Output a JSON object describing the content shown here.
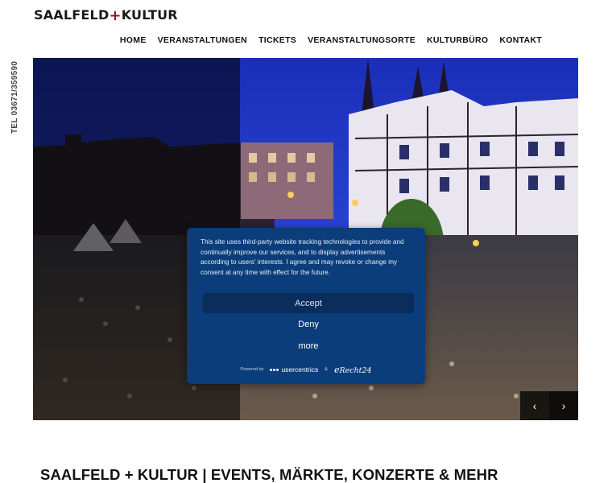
{
  "logo": {
    "left": "SAALFELD",
    "plus": "+",
    "right": "KULTUR"
  },
  "nav": {
    "items": [
      {
        "label": "HOME"
      },
      {
        "label": "VERANSTALTUNGEN"
      },
      {
        "label": "TICKETS"
      },
      {
        "label": "VERANSTALTUNGSORTE"
      },
      {
        "label": "KULTURBÜRO"
      },
      {
        "label": "KONTAKT"
      }
    ]
  },
  "phone": "TEL 03671/359590",
  "hero": {
    "prev_icon": "chevron-left-icon",
    "next_icon": "chevron-right-icon",
    "prev_glyph": "‹",
    "next_glyph": "›"
  },
  "consent": {
    "text": "This site uses third-party website tracking technologies to provide and continually improve our services, and to display advertisements according to users' interests. I agree and may revoke or change my consent at any time with effect for the future.",
    "accept": "Accept",
    "deny": "Deny",
    "more": "more",
    "powered_by": "Powered by",
    "usercentrics": "usercentrics",
    "amp": "&",
    "erecht_e": "e",
    "erecht": "Recht24"
  },
  "heading": "SAALFELD + KULTUR | EVENTS, MÄRKTE, KONZERTE & MEHR",
  "colors": {
    "consent_bg": "#0a3d7a",
    "accept_bg": "#0a2d5c",
    "logo_plus": "#8b1a1a"
  }
}
